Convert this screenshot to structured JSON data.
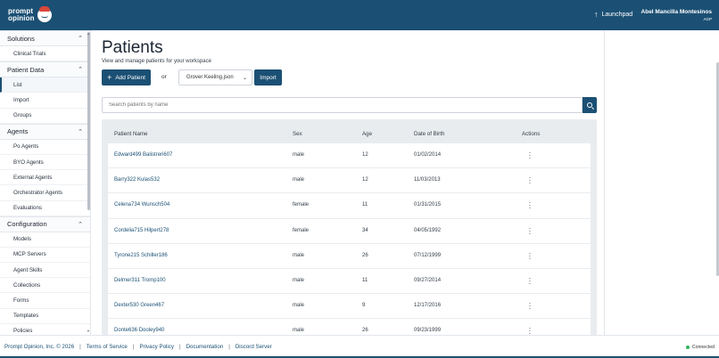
{
  "header": {
    "logo_line1": "prompt",
    "logo_line2": "opinion",
    "launchpad_label": "Launchpad",
    "user_name": "Abel Mancilla Montesinos",
    "user_org": "AGP"
  },
  "sidebar": {
    "sections": [
      {
        "title": "Solutions",
        "items": [
          "Clinical Trials"
        ]
      },
      {
        "title": "Patient Data",
        "items": [
          "List",
          "Import",
          "Groups"
        ]
      },
      {
        "title": "Agents",
        "items": [
          "Po Agents",
          "BYO Agents",
          "External Agents",
          "Orchestrator Agents",
          "Evaluations"
        ]
      },
      {
        "title": "Configuration",
        "items": [
          "Models",
          "MCP Servers",
          "Agent Skills",
          "Collections",
          "Forms",
          "Templates",
          "Policies"
        ]
      }
    ],
    "active_item": "List"
  },
  "main": {
    "title": "Patients",
    "subtitle": "View and manage patients for your workspace",
    "add_patient_label": "Add Patient",
    "or_label": "or",
    "file_select_value": "Grover Keeling.json",
    "import_label": "Import",
    "search_placeholder": "Search patients by name"
  },
  "table": {
    "columns": [
      "Patient Name",
      "Sex",
      "Age",
      "Date of Birth",
      "Actions"
    ],
    "rows": [
      {
        "name": "Edward499 Balistreri607",
        "sex": "male",
        "age": "12",
        "dob": "01/02/2014"
      },
      {
        "name": "Barry322 Kulas532",
        "sex": "male",
        "age": "12",
        "dob": "11/03/2013"
      },
      {
        "name": "Celena734 Wunsch504",
        "sex": "female",
        "age": "11",
        "dob": "01/31/2015"
      },
      {
        "name": "Cordelia715 Hilpert278",
        "sex": "female",
        "age": "34",
        "dob": "04/05/1992"
      },
      {
        "name": "Tyrone215 Schiller186",
        "sex": "male",
        "age": "26",
        "dob": "07/12/1999"
      },
      {
        "name": "Delmer311 Tromp100",
        "sex": "male",
        "age": "11",
        "dob": "09/27/2014"
      },
      {
        "name": "Dexter530 Green467",
        "sex": "male",
        "age": "9",
        "dob": "12/17/2016"
      },
      {
        "name": "Donte636 Dooley940",
        "sex": "male",
        "age": "26",
        "dob": "09/23/1999"
      }
    ]
  },
  "footer": {
    "copyright": "Prompt Opinion, Inc. © 2026",
    "links": [
      "Terms of Service",
      "Privacy Policy",
      "Documentation",
      "Discord Server"
    ],
    "status": "Connected"
  },
  "colors": {
    "primary": "#1b5074",
    "status_ok": "#2fb55b"
  }
}
